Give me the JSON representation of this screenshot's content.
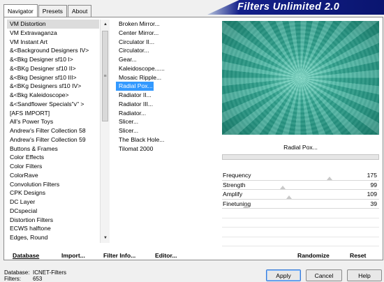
{
  "tabs": [
    "Navigator",
    "Presets",
    "About"
  ],
  "brand": "Filters Unlimited 2.0",
  "categories": [
    "VM Distortion",
    "VM Extravaganza",
    "VM Instant Art",
    "&<Background Designers IV>",
    "&<Bkg Designer sf10 I>",
    "&<BKg Designer sf10 II>",
    "&<Bkg Designer sf10 III>",
    "&<BKg Designers sf10 IV>",
    "&<Bkg Kaleidoscope>",
    "&<Sandflower Specials\"v\" >",
    "[AFS IMPORT]",
    "All's Power Toys",
    "Andrew's Filter Collection 58",
    "Andrew's Filter Collection 59",
    "Buttons & Frames",
    "Color Effects",
    "Color Filters",
    "ColorRave",
    "Convolution Filters",
    "CPK Designs",
    "DC Layer",
    "DCspecial",
    "Distortion Filters",
    "ECWS halftone",
    "Edges, Round"
  ],
  "filters": [
    "Broken Mirror...",
    "Center Mirror...",
    "Circulator II...",
    "Circulator...",
    "Gear...",
    "Kaleidoscope......",
    "Mosaic Ripple...",
    "Radial Pox...",
    "Radiator II...",
    "Radiator III...",
    "Radiator...",
    "Slicer...",
    "Slicer...",
    "The Black Hole...",
    "Tilomat 2000"
  ],
  "selected_filter": "Radial Pox...",
  "params": [
    {
      "label": "Frequency",
      "value": "175",
      "level": 0.686
    },
    {
      "label": "Strength",
      "value": "99",
      "level": 0.388
    },
    {
      "label": "Amplify",
      "value": "109",
      "level": 0.427
    },
    {
      "label": "Finetuning",
      "value": "39",
      "level": 0.153
    }
  ],
  "commands": {
    "database": "Database",
    "import": "Import...",
    "filter_info": "Filter Info...",
    "editor": "Editor...",
    "randomize": "Randomize",
    "reset": "Reset"
  },
  "status": {
    "database_label": "Database:",
    "database_value": "ICNET-Filters",
    "filters_label": "Filters:",
    "filters_value": "653"
  },
  "buttons": {
    "apply": "Apply",
    "cancel": "Cancel",
    "help": "Help"
  },
  "colors": {
    "accent": "#3399ff",
    "brand_bg": "#0a1570"
  }
}
